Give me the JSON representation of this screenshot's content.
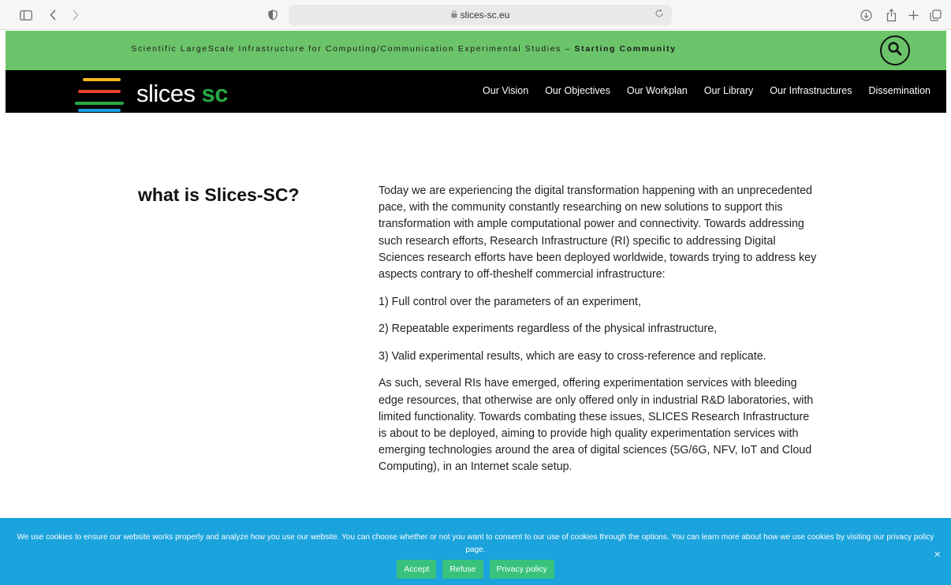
{
  "browser": {
    "url": "slices-sc.eu"
  },
  "banner": {
    "tagline_main": "Scientific LargeScale Infrastructure for Computing/Communication Experimental Studies – ",
    "tagline_bold": "Starting Community"
  },
  "logo": {
    "text": "slices",
    "suffix": "sc",
    "colors": [
      "#f5b81c",
      "#e8412c",
      "#27a844",
      "#1a9fe0"
    ]
  },
  "nav": {
    "items": [
      {
        "label": "Our Vision"
      },
      {
        "label": "Our Objectives"
      },
      {
        "label": "Our Workplan"
      },
      {
        "label": "Our Library"
      },
      {
        "label": "Our Infrastructures"
      },
      {
        "label": "Dissemination"
      }
    ]
  },
  "main": {
    "heading": "what is Slices-SC?",
    "paragraphs": [
      "Today we are experiencing the digital transformation happening with an unprecedented pace, with the community constantly researching on new solutions to support this transformation with ample computational power and connectivity. Towards addressing such research efforts, Research Infrastructure (RI) specific to addressing Digital Sciences research efforts have been deployed worldwide, towards trying to address key aspects contrary to off-theshelf commercial infrastructure:",
      "1) Full control over the parameters of an experiment,",
      "2) Repeatable experiments regardless of the physical infrastructure,",
      "3) Valid experimental results, which are easy to cross-reference and replicate.",
      "As such, several RIs have emerged, offering experimentation services with bleeding edge resources, that otherwise are only offered only in industrial R&D laboratories, with limited functionality. Towards combating these issues, SLICES Research Infrastructure is about to be deployed, aiming to provide high quality experimentation services with emerging technologies around the area of digital sciences (5G/6G, NFV, IoT and Cloud Computing), in an Internet scale setup."
    ]
  },
  "cookie": {
    "message": "We use cookies to ensure our website works properly and analyze how you use our website. You can choose whether or not you want to consent to our use of cookies through the options. You can learn more about how we use cookies by visiting our privacy policy page.",
    "accept": "Accept",
    "refuse": "Refuse",
    "privacy": "Privacy policy",
    "close": "×"
  },
  "colors": {
    "banner": "#6cc46a",
    "nav": "#000000",
    "cookie_bg": "#1aa3dc",
    "cookie_button": "#38c27c"
  }
}
